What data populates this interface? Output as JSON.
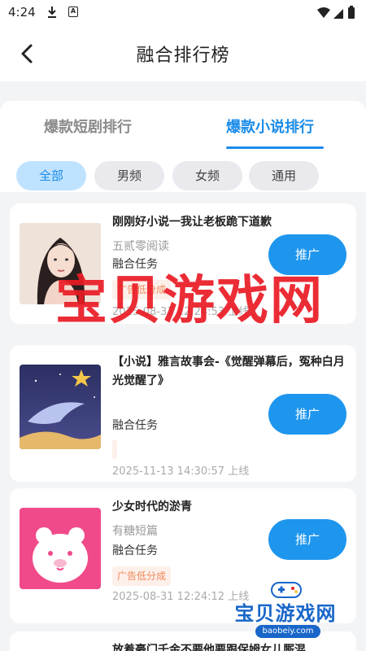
{
  "status_bar": {
    "time": "4:24"
  },
  "header": {
    "title": "融合排行榜"
  },
  "tabs": [
    {
      "label": "爆款短剧排行",
      "active": false
    },
    {
      "label": "爆款小说排行",
      "active": true
    }
  ],
  "filters": [
    {
      "label": "全部",
      "active": true
    },
    {
      "label": "男频",
      "active": false
    },
    {
      "label": "女频",
      "active": false
    },
    {
      "label": "通用",
      "active": false
    }
  ],
  "cards": [
    {
      "title": "刚刚好小说一我让老板跪下道歉",
      "source": "五贰零阅读",
      "task": "融合任务",
      "tag": "广告低分成",
      "time": "2025-08-31 12:24:53 上线",
      "button": "推广"
    },
    {
      "title": "【小说】雅言故事会-《觉醒弹幕后，冤种白月光觉醒了》",
      "task": "融合任务",
      "time": "2025-11-13 14:30:57 上线",
      "button": "推广"
    },
    {
      "title": "少女时代的淤青",
      "source": "有糖短篇",
      "task": "融合任务",
      "tag": "广告低分成",
      "time": "2025-08-31 12:24:12 上线",
      "button": "推广"
    },
    {
      "title": "放着豪门千金不要他要跟保姆女儿厮混"
    }
  ],
  "watermark": {
    "text": "宝贝游戏网",
    "small_text": "宝贝游戏网",
    "url": "baobeiy.com"
  },
  "colors": {
    "accent": "#1a8be8",
    "button": "#1e96ee",
    "tag": "#f2885a",
    "watermark": "#ea1b24"
  }
}
